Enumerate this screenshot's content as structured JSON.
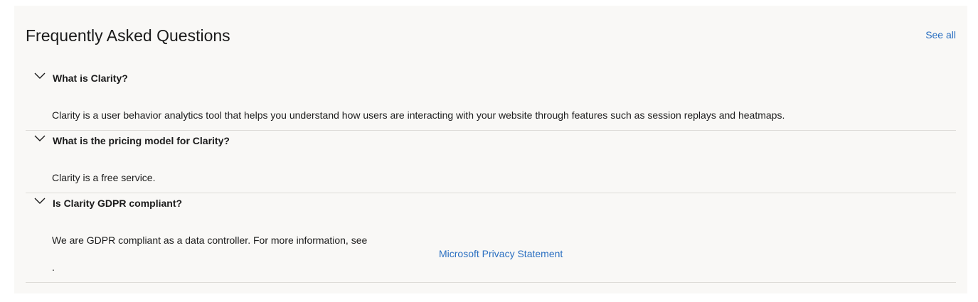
{
  "faq": {
    "title": "Frequently Asked Questions",
    "see_all": "See all",
    "items": [
      {
        "question": "What is Clarity?",
        "answer": "Clarity is a user behavior analytics tool that helps you understand how users are interacting with your website through features such as session replays and heatmaps."
      },
      {
        "question": "What is the pricing model for Clarity?",
        "answer": "Clarity is a free service."
      },
      {
        "question": "Is Clarity GDPR compliant?",
        "answer": "We are GDPR compliant as a data controller. For more information, see",
        "link_text": "Microsoft Privacy Statement",
        "answer_suffix": "."
      }
    ]
  },
  "colors": {
    "panel_background": "#f9f8f6",
    "link": "#2a6fc1",
    "divider": "#dedcd8"
  },
  "icons": {
    "expand": "chevron-down-icon"
  }
}
